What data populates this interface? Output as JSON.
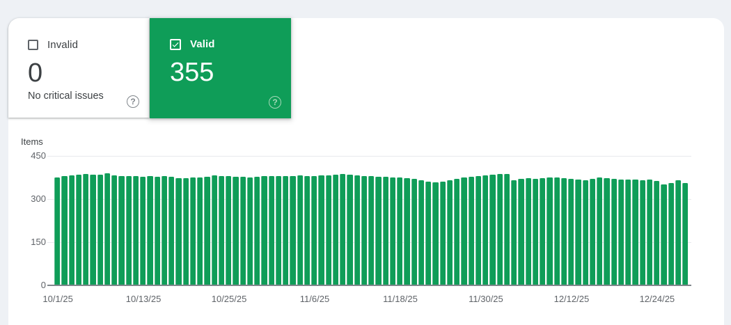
{
  "cards": {
    "invalid": {
      "label": "Invalid",
      "value": "0",
      "caption": "No critical issues",
      "checked": false
    },
    "valid": {
      "label": "Valid",
      "value": "355",
      "checked": true
    }
  },
  "icons": {
    "help_glyph": "?"
  },
  "colors": {
    "valid_green": "#0f9d58",
    "bar_green": "#0f9d58",
    "page_background": "#eef1f5",
    "axis_text": "#5f6368",
    "dark_text": "#3c4043"
  },
  "chart_data": {
    "type": "bar",
    "title": "Items",
    "ylabel": "Items",
    "xlabel": "",
    "ylim": [
      0,
      450
    ],
    "yticks": [
      450,
      300,
      150,
      0
    ],
    "grid": "horizontal",
    "legend": "none",
    "x_tick_labels": [
      "10/1/25",
      "10/13/25",
      "10/25/25",
      "11/6/25",
      "11/18/25",
      "11/30/25",
      "12/12/25",
      "12/24/25"
    ],
    "x_tick_indices": [
      0,
      12,
      24,
      36,
      48,
      60,
      72,
      84
    ],
    "bar_count": 89,
    "series": [
      {
        "name": "Valid",
        "color": "#0f9d58",
        "values": [
          375,
          380,
          382,
          385,
          387,
          385,
          384,
          389,
          383,
          380,
          381,
          380,
          378,
          379,
          378,
          380,
          378,
          373,
          372,
          375,
          375,
          378,
          382,
          381,
          380,
          378,
          377,
          375,
          378,
          381,
          380,
          379,
          381,
          380,
          382,
          381,
          380,
          382,
          383,
          384,
          386,
          385,
          383,
          381,
          379,
          378,
          377,
          375,
          374,
          372,
          369,
          365,
          360,
          357,
          361,
          366,
          370,
          374,
          378,
          381,
          383,
          385,
          388,
          386,
          366,
          370,
          372,
          370,
          373,
          376,
          374,
          372,
          370,
          368,
          366,
          370,
          374,
          372,
          370,
          368,
          367,
          368,
          365,
          368,
          363,
          351,
          356,
          365,
          355
        ]
      }
    ]
  }
}
